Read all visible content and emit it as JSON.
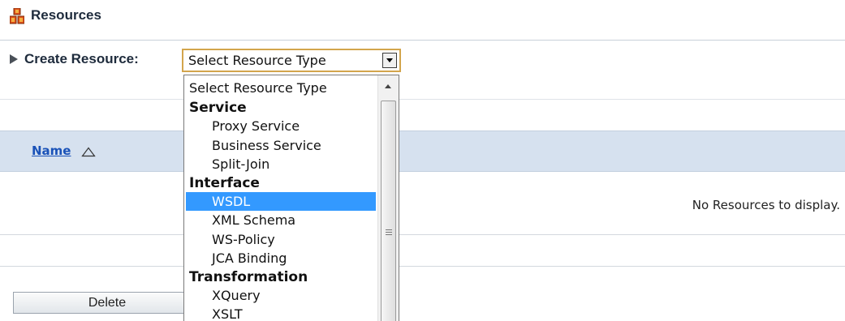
{
  "header": {
    "title": "Resources",
    "icon": "resources-icon"
  },
  "create_resource": {
    "label": "Create Resource:",
    "select_value": "Select Resource Type",
    "dropdown_open": true,
    "options": [
      {
        "label": "Select Resource Type",
        "kind": "placeholder"
      },
      {
        "label": "Service",
        "kind": "group"
      },
      {
        "label": "Proxy Service",
        "kind": "option"
      },
      {
        "label": "Business Service",
        "kind": "option"
      },
      {
        "label": "Split-Join",
        "kind": "option"
      },
      {
        "label": "Interface",
        "kind": "group"
      },
      {
        "label": "WSDL",
        "kind": "option",
        "selected": true
      },
      {
        "label": "XML Schema",
        "kind": "option"
      },
      {
        "label": "WS-Policy",
        "kind": "option"
      },
      {
        "label": "JCA Binding",
        "kind": "option"
      },
      {
        "label": "Transformation",
        "kind": "group"
      },
      {
        "label": "XQuery",
        "kind": "option"
      },
      {
        "label": "XSLT",
        "kind": "option"
      }
    ]
  },
  "table": {
    "columns": [
      {
        "label": "Name",
        "sort": "ascending"
      }
    ],
    "empty_message": "No Resources to display."
  },
  "actions": {
    "delete_label": "Delete"
  },
  "colors": {
    "selection": "#3399ff",
    "table_header_bg": "#d6e1ef",
    "link": "#1a52b8",
    "select_focus_border": "#d3a54c"
  }
}
